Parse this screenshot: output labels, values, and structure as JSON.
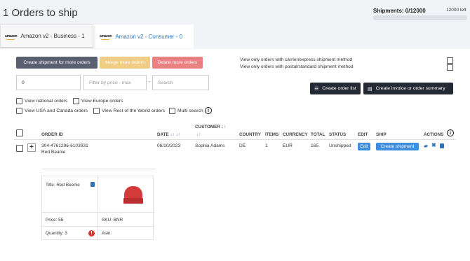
{
  "header": {
    "title": "1 Orders to ship",
    "shipments_label": "Shipments: 0/12000",
    "shipments_left": "12000 left",
    "shipments_progress": 0
  },
  "tabs": [
    {
      "brand": "amazon",
      "label": "Amazon v2 - Business - 1",
      "active": true
    },
    {
      "brand": "amazon",
      "label": "Amazon v2 - Consumer - 0",
      "active": false
    }
  ],
  "actions": {
    "create_more": "Create shipment for more orders",
    "merge_more": "Merge more orders",
    "delete_more": "Delete more orders",
    "view_carrier": "View only orders with carrier/express shipment method",
    "view_postal": "View only orders with postal/standard shipment method",
    "create_list": "Create order list",
    "create_invoice": "Create invoice or order summary"
  },
  "filters": {
    "count_value": "0",
    "price_placeholder": "Filter by price - max",
    "dash": "-",
    "search_placeholder": "Search",
    "national": "View national orders",
    "europe": "View Europe orders",
    "usa_canada": "View USA and Canada orders",
    "rest_world": "View Rest of the World orders",
    "multi_search": "Multi search"
  },
  "table": {
    "headers": {
      "order_id": "ORDER ID",
      "date": "DATE",
      "customer": "CUSTOMER",
      "country": "COUNTRY",
      "items": "ITEMS",
      "currency": "CURRENCY",
      "total": "TOTAL",
      "status": "STATUS",
      "edit": "EDIT",
      "ship": "SHIP",
      "actions": "ACTIONS"
    },
    "rows": [
      {
        "order_id": "304-4761296-6103931",
        "product": "Red Beanie",
        "date": "06/10/2023",
        "customer": "Sophia Adams",
        "country": "DE",
        "items": "1",
        "currency": "EUR",
        "total": "165",
        "status": "Unshipped",
        "edit": "Edit",
        "ship": "Create shipment"
      }
    ]
  },
  "product_card": {
    "title": "Title: Red Beenie",
    "price": "Price: 55",
    "sku": "SKU: BNR",
    "quantity": "Quantity: 3",
    "asin": "Asin:",
    "image_color": "#d43c3c"
  },
  "icons": {
    "sort": "sort-arrows",
    "info": "info-circle",
    "list": "list-icon",
    "document": "document-icon",
    "folder": "folder-icon",
    "close": "x-icon",
    "note": "note-icon",
    "alert": "alert-icon"
  },
  "colors": {
    "accent": "#3d8de0",
    "dark": "#242a35",
    "merge": "#f0cd85",
    "delete": "#ec7f82"
  }
}
